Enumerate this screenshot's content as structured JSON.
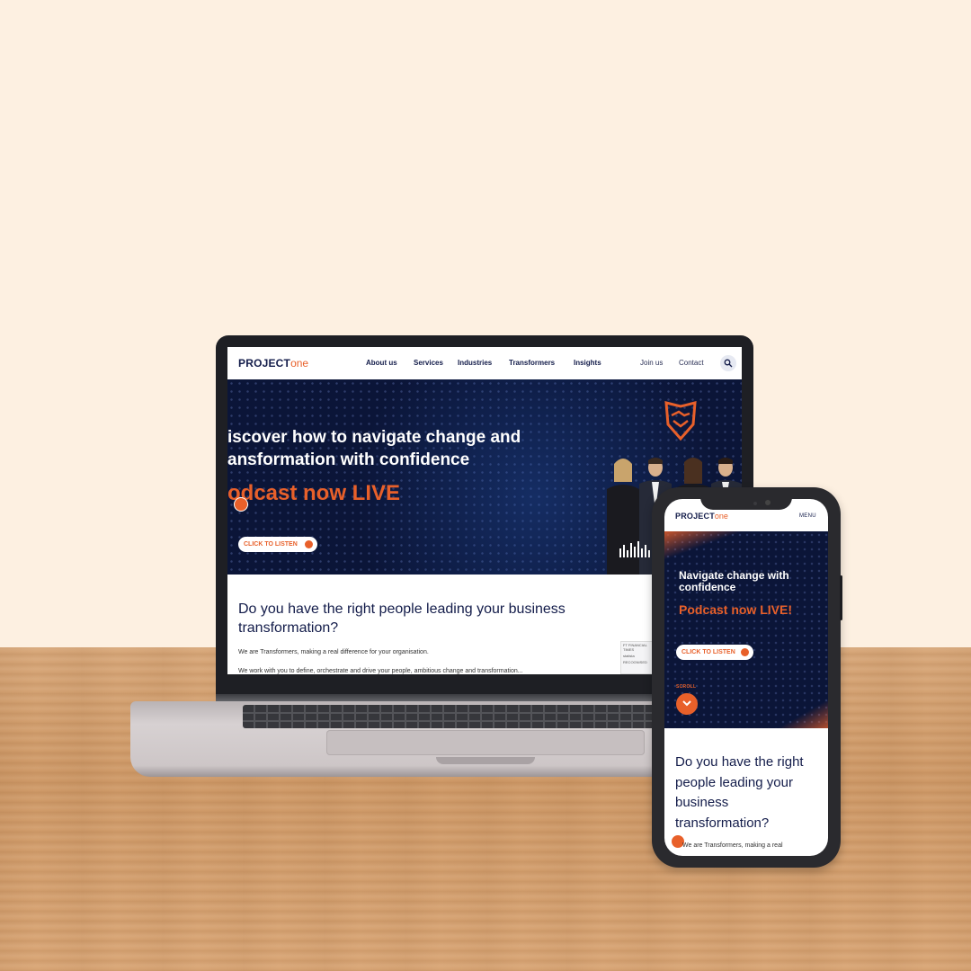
{
  "brand": {
    "logo_project": "PROJECT",
    "logo_one": "one",
    "accent": "#e8602a",
    "navy": "#131c4a"
  },
  "desktop": {
    "nav": {
      "items": [
        "About us",
        "Services",
        "Industries",
        "Transformers",
        "Insights"
      ],
      "join": "Join us",
      "contact": "Contact",
      "search_icon": "search-icon"
    },
    "hero": {
      "line1": "iscover how to navigate change and",
      "line2": "ansformation with confidence",
      "podcast": "odcast now LIVE",
      "cta": "CLICK TO LISTEN"
    },
    "section": {
      "heading": "Do you have the right people leading your business transformation?",
      "intro": "We are Transformers, making a real difference for your organisation.",
      "body": "We work with you to define, orchestrate and drive your people, ambitious change and transformation..."
    },
    "logos": [
      "FT FINANCIAL TIMES",
      "statista",
      "RECOGNISED"
    ]
  },
  "mobile": {
    "menu": "MENU",
    "hero": {
      "title": "Navigate change with confidence",
      "podcast": "Podcast now LIVE!",
      "cta": "CLICK TO LISTEN",
      "scroll": "SCROLL"
    },
    "section": {
      "heading": "Do you have the right people leading your business transformation?",
      "intro": "We are Transformers, making a real"
    }
  }
}
